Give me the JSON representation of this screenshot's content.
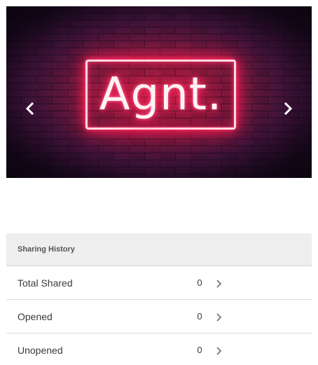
{
  "carousel": {
    "slide_text": "Agnt.",
    "prev_icon": "chevron-left-icon",
    "next_icon": "chevron-right-icon"
  },
  "sharing_history": {
    "title": "Sharing History",
    "rows": [
      {
        "label": "Total Shared",
        "count": "0",
        "icon": "chevron-right-icon"
      },
      {
        "label": "Opened",
        "count": "0",
        "icon": "chevron-right-icon"
      },
      {
        "label": "Unopened",
        "count": "0",
        "icon": "chevron-right-icon"
      }
    ]
  },
  "colors": {
    "neon_pink": "#ff1e55",
    "brick_background": "#2a0f33",
    "header_background": "#eeeeee"
  }
}
